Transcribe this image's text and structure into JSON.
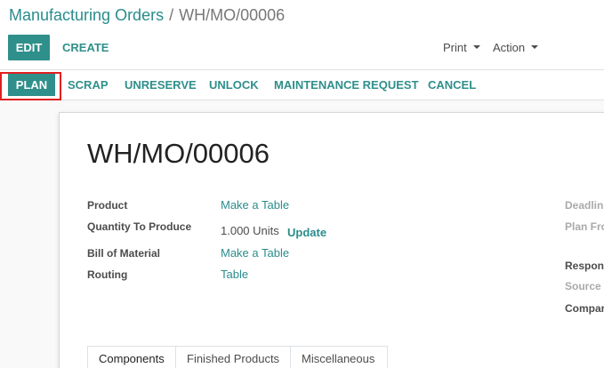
{
  "breadcrumb": {
    "parent": "Manufacturing Orders",
    "separator": "/",
    "current": "WH/MO/00006"
  },
  "control": {
    "edit_label": "EDIT",
    "create_label": "CREATE",
    "print_label": "Print",
    "action_label": "Action"
  },
  "statusbar": {
    "plan_label": "PLAN",
    "scrap_label": "SCRAP",
    "unreserve_label": "UNRESERVE",
    "unlock_label": "UNLOCK",
    "maintenance_label": "MAINTENANCE REQUEST",
    "cancel_label": "CANCEL"
  },
  "record": {
    "title": "WH/MO/00006",
    "fields": {
      "product_label": "Product",
      "product_value": "Make a Table",
      "qty_label": "Quantity To Produce",
      "qty_value": "1.000 Units",
      "qty_update": "Update",
      "bom_label": "Bill of Material",
      "bom_value": "Make a Table",
      "routing_label": "Routing",
      "routing_value": "Table"
    },
    "right_fields": {
      "deadline_label": "Deadlin",
      "plan_from_label": "Plan Fro",
      "responsible_label": "Respon",
      "source_label": "Source",
      "company_label": "Compar"
    }
  },
  "tabs": [
    {
      "label": "Components"
    },
    {
      "label": "Finished Products"
    },
    {
      "label": "Miscellaneous"
    }
  ],
  "colors": {
    "accent": "#2f8f8b",
    "highlight": "#e02020"
  }
}
